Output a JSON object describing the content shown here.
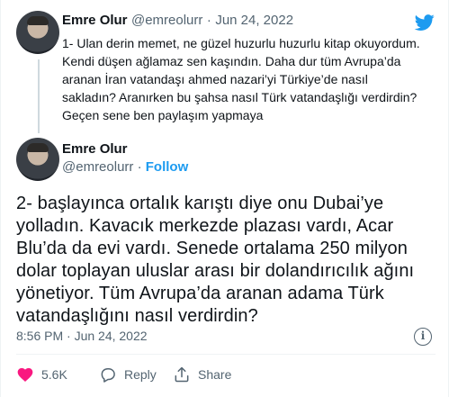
{
  "tweet1": {
    "name": "Emre Olur",
    "handle": "@emreolurr",
    "separator": "·",
    "date": "Jun 24, 2022",
    "text": "1- Ulan derin memet, ne güzel huzurlu huzurlu kitap okuyordum. Kendi düşen ağlamaz sen kaşındın. Daha dur tüm Avrupa’da aranan İran vatandaşı ahmed nazari’yi Türkiye’de nasıl sakladın? Aranırken bu şahsa nasıl Türk vatandaşlığı verdirdin? Geçen sene ben paylaşım yapmaya"
  },
  "tweet2": {
    "name": "Emre Olur",
    "handle": "@emreolurr",
    "separator": "·",
    "follow_label": "Follow",
    "text": "2- başlayınca ortalık karıştı diye onu Dubai’ye yolladın. Kavacık merkezde plazası vardı, Acar Blu’da da evi vardı. Senede ortalama 250 milyon dolar toplayan uluslar arası bir dolandırıcılık ağını yönetiyor. Tüm Avrupa’da aranan adama Türk vatandaşlığını nasıl verdirdin?",
    "timestamp": "8:56 PM · Jun 24, 2022"
  },
  "actions": {
    "likes": "5.6K",
    "reply_label": "Reply",
    "share_label": "Share"
  },
  "icons": {
    "brand": "twitter-bird-icon",
    "info": "info-icon",
    "like": "heart-icon",
    "reply": "reply-icon",
    "share": "share-icon"
  },
  "colors": {
    "accent": "#1d9bf0",
    "like": "#f91880",
    "text": "#0f1419",
    "muted": "#536471"
  }
}
